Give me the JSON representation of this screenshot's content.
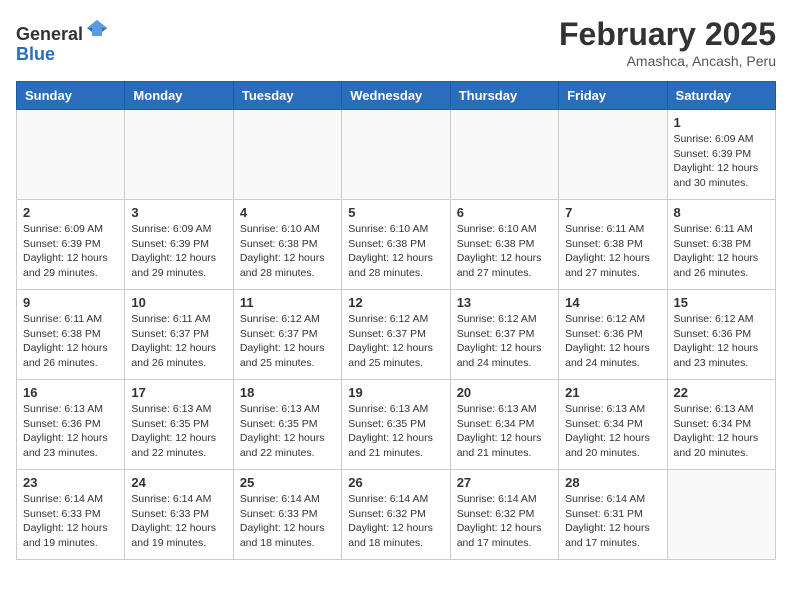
{
  "logo": {
    "general": "General",
    "blue": "Blue"
  },
  "title": "February 2025",
  "subtitle": "Amashca, Ancash, Peru",
  "days_of_week": [
    "Sunday",
    "Monday",
    "Tuesday",
    "Wednesday",
    "Thursday",
    "Friday",
    "Saturday"
  ],
  "weeks": [
    [
      {
        "day": "",
        "info": ""
      },
      {
        "day": "",
        "info": ""
      },
      {
        "day": "",
        "info": ""
      },
      {
        "day": "",
        "info": ""
      },
      {
        "day": "",
        "info": ""
      },
      {
        "day": "",
        "info": ""
      },
      {
        "day": "1",
        "info": "Sunrise: 6:09 AM\nSunset: 6:39 PM\nDaylight: 12 hours and 30 minutes."
      }
    ],
    [
      {
        "day": "2",
        "info": "Sunrise: 6:09 AM\nSunset: 6:39 PM\nDaylight: 12 hours and 29 minutes."
      },
      {
        "day": "3",
        "info": "Sunrise: 6:09 AM\nSunset: 6:39 PM\nDaylight: 12 hours and 29 minutes."
      },
      {
        "day": "4",
        "info": "Sunrise: 6:10 AM\nSunset: 6:38 PM\nDaylight: 12 hours and 28 minutes."
      },
      {
        "day": "5",
        "info": "Sunrise: 6:10 AM\nSunset: 6:38 PM\nDaylight: 12 hours and 28 minutes."
      },
      {
        "day": "6",
        "info": "Sunrise: 6:10 AM\nSunset: 6:38 PM\nDaylight: 12 hours and 27 minutes."
      },
      {
        "day": "7",
        "info": "Sunrise: 6:11 AM\nSunset: 6:38 PM\nDaylight: 12 hours and 27 minutes."
      },
      {
        "day": "8",
        "info": "Sunrise: 6:11 AM\nSunset: 6:38 PM\nDaylight: 12 hours and 26 minutes."
      }
    ],
    [
      {
        "day": "9",
        "info": "Sunrise: 6:11 AM\nSunset: 6:38 PM\nDaylight: 12 hours and 26 minutes."
      },
      {
        "day": "10",
        "info": "Sunrise: 6:11 AM\nSunset: 6:37 PM\nDaylight: 12 hours and 26 minutes."
      },
      {
        "day": "11",
        "info": "Sunrise: 6:12 AM\nSunset: 6:37 PM\nDaylight: 12 hours and 25 minutes."
      },
      {
        "day": "12",
        "info": "Sunrise: 6:12 AM\nSunset: 6:37 PM\nDaylight: 12 hours and 25 minutes."
      },
      {
        "day": "13",
        "info": "Sunrise: 6:12 AM\nSunset: 6:37 PM\nDaylight: 12 hours and 24 minutes."
      },
      {
        "day": "14",
        "info": "Sunrise: 6:12 AM\nSunset: 6:36 PM\nDaylight: 12 hours and 24 minutes."
      },
      {
        "day": "15",
        "info": "Sunrise: 6:12 AM\nSunset: 6:36 PM\nDaylight: 12 hours and 23 minutes."
      }
    ],
    [
      {
        "day": "16",
        "info": "Sunrise: 6:13 AM\nSunset: 6:36 PM\nDaylight: 12 hours and 23 minutes."
      },
      {
        "day": "17",
        "info": "Sunrise: 6:13 AM\nSunset: 6:35 PM\nDaylight: 12 hours and 22 minutes."
      },
      {
        "day": "18",
        "info": "Sunrise: 6:13 AM\nSunset: 6:35 PM\nDaylight: 12 hours and 22 minutes."
      },
      {
        "day": "19",
        "info": "Sunrise: 6:13 AM\nSunset: 6:35 PM\nDaylight: 12 hours and 21 minutes."
      },
      {
        "day": "20",
        "info": "Sunrise: 6:13 AM\nSunset: 6:34 PM\nDaylight: 12 hours and 21 minutes."
      },
      {
        "day": "21",
        "info": "Sunrise: 6:13 AM\nSunset: 6:34 PM\nDaylight: 12 hours and 20 minutes."
      },
      {
        "day": "22",
        "info": "Sunrise: 6:13 AM\nSunset: 6:34 PM\nDaylight: 12 hours and 20 minutes."
      }
    ],
    [
      {
        "day": "23",
        "info": "Sunrise: 6:14 AM\nSunset: 6:33 PM\nDaylight: 12 hours and 19 minutes."
      },
      {
        "day": "24",
        "info": "Sunrise: 6:14 AM\nSunset: 6:33 PM\nDaylight: 12 hours and 19 minutes."
      },
      {
        "day": "25",
        "info": "Sunrise: 6:14 AM\nSunset: 6:33 PM\nDaylight: 12 hours and 18 minutes."
      },
      {
        "day": "26",
        "info": "Sunrise: 6:14 AM\nSunset: 6:32 PM\nDaylight: 12 hours and 18 minutes."
      },
      {
        "day": "27",
        "info": "Sunrise: 6:14 AM\nSunset: 6:32 PM\nDaylight: 12 hours and 17 minutes."
      },
      {
        "day": "28",
        "info": "Sunrise: 6:14 AM\nSunset: 6:31 PM\nDaylight: 12 hours and 17 minutes."
      },
      {
        "day": "",
        "info": ""
      }
    ]
  ]
}
